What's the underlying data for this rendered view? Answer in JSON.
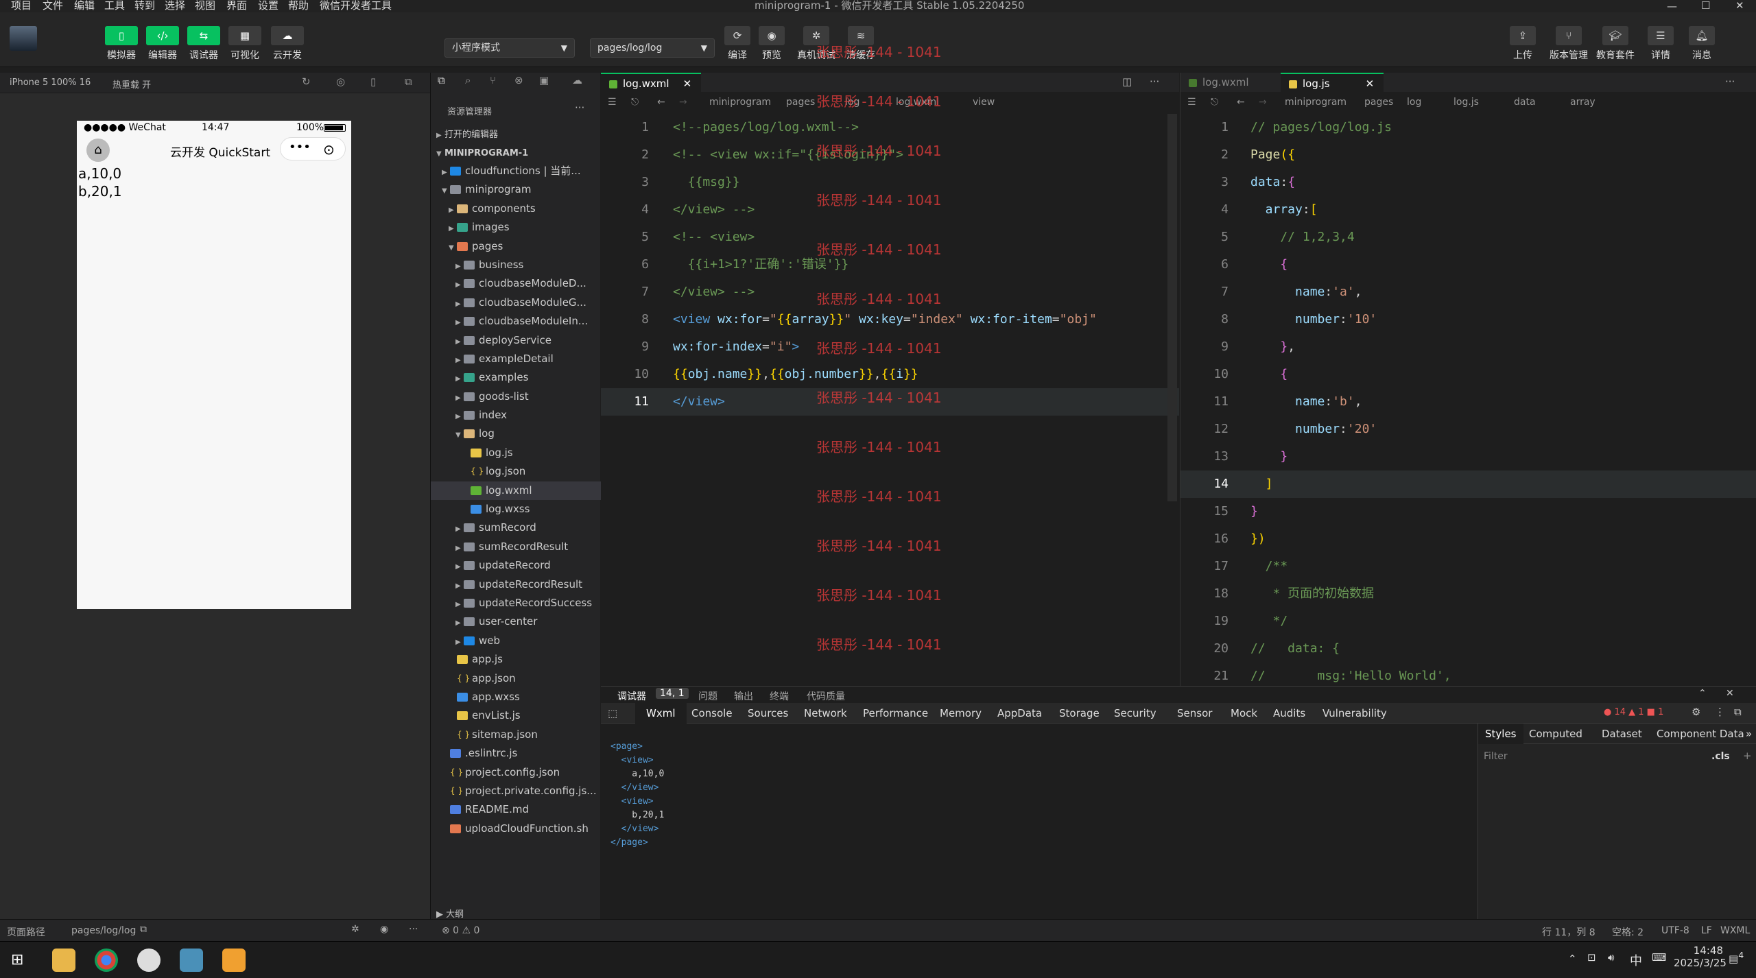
{
  "menu": {
    "items": [
      "项目",
      "文件",
      "编辑",
      "工具",
      "转到",
      "选择",
      "视图",
      "界面",
      "设置",
      "帮助",
      "微信开发者工具"
    ],
    "title": "miniprogram-1 - 微信开发者工具 Stable 1.05.2204250"
  },
  "toolbar": {
    "left": [
      "模拟器",
      "编辑器",
      "调试器",
      "可视化",
      "云开发"
    ],
    "mode": "小程序模式",
    "page": "pages/log/log",
    "mid": [
      "编译",
      "预览",
      "真机调试",
      "清缓存"
    ],
    "right": [
      "上传",
      "版本管理",
      "教育套件",
      "详情",
      "消息"
    ]
  },
  "sim": {
    "device": "iPhone 5 100% 16",
    "hot": "热重载 开",
    "signal": "●●●●● WeChat",
    "time": "14:47",
    "battery": "100%",
    "nav_title": "云开发 QuickStart",
    "lines": [
      "a,10,0",
      "b,20,1"
    ]
  },
  "explorer": {
    "title": "资源管理器",
    "open": "打开的编辑器",
    "root": "MINIPROGRAM-1",
    "outline": "大纲",
    "items": [
      {
        "n": "cloudfunctions | 当前...",
        "d": 1,
        "t": "foldc",
        "tw": "▶"
      },
      {
        "n": "miniprogram",
        "d": 1,
        "t": "fold",
        "tw": "▼"
      },
      {
        "n": "components",
        "d": 2,
        "t": "foldb",
        "tw": "▶"
      },
      {
        "n": "images",
        "d": 2,
        "t": "foldg",
        "tw": "▶"
      },
      {
        "n": "pages",
        "d": 2,
        "t": "foldr",
        "tw": "▼"
      },
      {
        "n": "business",
        "d": 3,
        "t": "fold",
        "tw": "▶"
      },
      {
        "n": "cloudbaseModuleD...",
        "d": 3,
        "t": "fold",
        "tw": "▶"
      },
      {
        "n": "cloudbaseModuleG...",
        "d": 3,
        "t": "fold",
        "tw": "▶"
      },
      {
        "n": "cloudbaseModuleIn...",
        "d": 3,
        "t": "fold",
        "tw": "▶"
      },
      {
        "n": "deployService",
        "d": 3,
        "t": "fold",
        "tw": "▶"
      },
      {
        "n": "exampleDetail",
        "d": 3,
        "t": "fold",
        "tw": "▶"
      },
      {
        "n": "examples",
        "d": 3,
        "t": "foldg",
        "tw": "▶"
      },
      {
        "n": "goods-list",
        "d": 3,
        "t": "fold",
        "tw": "▶"
      },
      {
        "n": "index",
        "d": 3,
        "t": "fold",
        "tw": "▶"
      },
      {
        "n": "log",
        "d": 3,
        "t": "foldb",
        "tw": "▼"
      },
      {
        "n": "log.js",
        "d": 4,
        "t": "fjs",
        "tw": ""
      },
      {
        "n": "log.json",
        "d": 4,
        "t": "fjson",
        "tw": ""
      },
      {
        "n": "log.wxml",
        "d": 4,
        "t": "fwxml",
        "tw": "",
        "active": true
      },
      {
        "n": "log.wxss",
        "d": 4,
        "t": "fwxss",
        "tw": ""
      },
      {
        "n": "sumRecord",
        "d": 3,
        "t": "fold",
        "tw": "▶"
      },
      {
        "n": "sumRecordResult",
        "d": 3,
        "t": "fold",
        "tw": "▶"
      },
      {
        "n": "updateRecord",
        "d": 3,
        "t": "fold",
        "tw": "▶"
      },
      {
        "n": "updateRecordResult",
        "d": 3,
        "t": "fold",
        "tw": "▶"
      },
      {
        "n": "updateRecordSuccess",
        "d": 3,
        "t": "fold",
        "tw": "▶"
      },
      {
        "n": "user-center",
        "d": 3,
        "t": "fold",
        "tw": "▶"
      },
      {
        "n": "web",
        "d": 3,
        "t": "foldc",
        "tw": "▶"
      },
      {
        "n": "app.js",
        "d": 2,
        "t": "fjs",
        "tw": ""
      },
      {
        "n": "app.json",
        "d": 2,
        "t": "fjson",
        "tw": ""
      },
      {
        "n": "app.wxss",
        "d": 2,
        "t": "fwxss",
        "tw": ""
      },
      {
        "n": "envList.js",
        "d": 2,
        "t": "fjs",
        "tw": ""
      },
      {
        "n": "sitemap.json",
        "d": 2,
        "t": "fjson",
        "tw": ""
      },
      {
        "n": ".eslintrc.js",
        "d": 1,
        "t": "finfo",
        "tw": ""
      },
      {
        "n": "project.config.json",
        "d": 1,
        "t": "fjson",
        "tw": ""
      },
      {
        "n": "project.private.config.js...",
        "d": 1,
        "t": "fjson",
        "tw": ""
      },
      {
        "n": "README.md",
        "d": 1,
        "t": "finfo",
        "tw": ""
      },
      {
        "n": "uploadCloudFunction.sh",
        "d": 1,
        "t": "foldr",
        "tw": ""
      }
    ]
  },
  "editor1": {
    "tab": "log.wxml",
    "crumb": [
      "miniprogram",
      "pages",
      "log",
      "log.wxml",
      "view"
    ]
  },
  "editor2": {
    "tab_inactive": "log.wxml",
    "tab": "log.js",
    "crumb": [
      "miniprogram",
      "pages",
      "log",
      "log.js",
      "data",
      "array"
    ]
  },
  "watermark": "张思彤 -144 - 1041",
  "panel": {
    "tabs": [
      "调试器",
      "14, 1",
      "问题",
      "输出",
      "终端",
      "代码质量"
    ],
    "devtabs": [
      "Wxml",
      "Console",
      "Sources",
      "Network",
      "Performance",
      "Memory",
      "AppData",
      "Storage",
      "Security",
      "Sensor",
      "Mock",
      "Audits",
      "Vulnerability"
    ],
    "counts": "● 14 ▲ 1 ■ 1",
    "styletabs": [
      "Styles",
      "Computed",
      "Dataset",
      "Component Data"
    ],
    "filter": "Filter",
    "cls": ".cls",
    "tree": [
      "<page>",
      "  <view>",
      "    a,10,0",
      "  </view>",
      "  <view>",
      "    b,20,1",
      "  </view>",
      "</page>"
    ]
  },
  "status": {
    "path": "页面路径",
    "page": "pages/log/log",
    "errs": "⊗ 0 ⚠ 0",
    "pos": "行 11，列 8",
    "space": "空格: 2",
    "enc": "UTF-8",
    "eol": "LF",
    "lang": "WXML"
  },
  "taskbar": {
    "ime": "中",
    "time": "14:48",
    "date": "2025/3/25",
    "notif": "4"
  }
}
